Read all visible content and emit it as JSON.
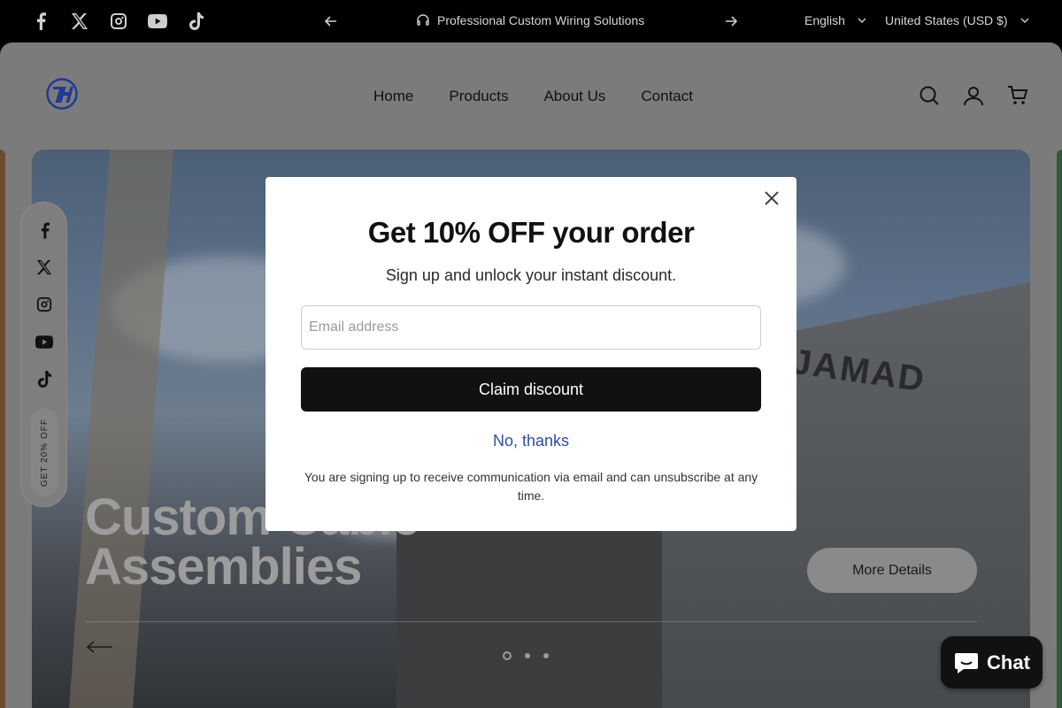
{
  "topbar": {
    "announcement": "Professional Custom Wiring Solutions",
    "language": "English",
    "currency": "United States (USD $)",
    "socials": [
      "facebook-icon",
      "x-icon",
      "instagram-icon",
      "youtube-icon",
      "tiktok-icon"
    ]
  },
  "header": {
    "logo_alt": "7H logo",
    "nav": [
      "Home",
      "Products",
      "About Us",
      "Contact"
    ],
    "icons": [
      "search-icon",
      "account-icon",
      "cart-icon"
    ]
  },
  "hero": {
    "title_line1": "Custom Cable",
    "title_line2": "Assemblies",
    "building_sign": "JAMAD",
    "button_label": "More Details",
    "slide_count": 3,
    "active_slide": 1
  },
  "float_bar": {
    "socials": [
      "facebook-icon",
      "x-icon",
      "instagram-icon",
      "youtube-icon",
      "tiktok-icon"
    ],
    "promo_label": "GET 20% OFF"
  },
  "modal": {
    "title": "Get 10% OFF your order",
    "subtitle": "Sign up and unlock your instant discount.",
    "email_placeholder": "Email address",
    "email_value": "",
    "claim_label": "Claim discount",
    "decline_label": "No, thanks",
    "fine_print": "You are signing up to receive communication via email and can unsubscribe at any time."
  },
  "chat": {
    "label": "Chat"
  },
  "colors": {
    "modal_bg": "#ffffff",
    "primary_button": "#111111",
    "link": "#2f4ea0",
    "logo_blue": "#1f3a93"
  }
}
